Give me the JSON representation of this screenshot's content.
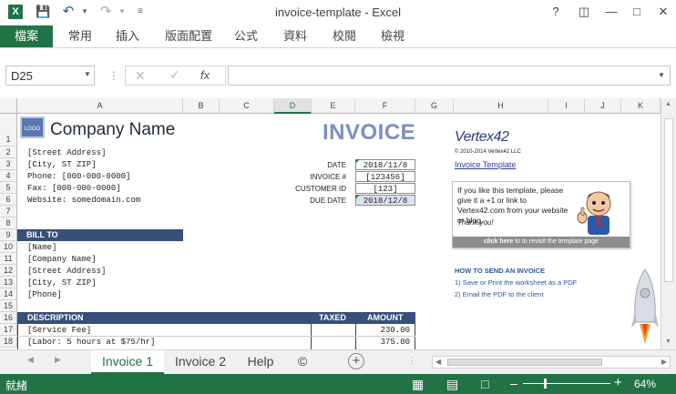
{
  "window": {
    "title": "invoice-template - Excel",
    "app_icon": "X",
    "help": "?"
  },
  "ribbon": {
    "tabs": [
      "檔案",
      "常用",
      "插入",
      "版面配置",
      "公式",
      "資料",
      "校閱",
      "檢視"
    ]
  },
  "formula_bar": {
    "name_box": "D25",
    "fx": "fx",
    "value": ""
  },
  "columns": [
    "A",
    "B",
    "C",
    "D",
    "E",
    "F",
    "G",
    "H",
    "I",
    "J",
    "K"
  ],
  "rows": [
    "1",
    "2",
    "3",
    "4",
    "5",
    "6",
    "7",
    "8",
    "9",
    "10",
    "11",
    "12",
    "13",
    "14",
    "15",
    "16",
    "17",
    "18"
  ],
  "sheet": {
    "logo_text": "LOGO",
    "company_name": "Company Name",
    "invoice_title": "INVOICE",
    "address_lines": [
      "[Street Address]",
      "[City, ST  ZIP]",
      "Phone: [000-000-0000]",
      "Fax: [000-000-0000]",
      "Website: somedomain.com"
    ],
    "meta_labels": [
      "DATE",
      "INVOICE #",
      "CUSTOMER ID",
      "DUE DATE"
    ],
    "meta_values": [
      "2018/11/8",
      "[123456]",
      "[123]",
      "2018/12/8"
    ],
    "bill_to_header": "BILL TO",
    "bill_to_lines": [
      "[Name]",
      "[Company Name]",
      "[Street Address]",
      "[City, ST  ZIP]",
      "[Phone]"
    ],
    "table_headers": {
      "description": "DESCRIPTION",
      "taxed": "TAXED",
      "amount": "AMOUNT"
    },
    "items": [
      {
        "description": "[Service Fee]",
        "amount": "230.00"
      },
      {
        "description": "[Labor: 5 hours at $75/hr]",
        "amount": "375.00"
      }
    ],
    "vertex_brand": "Vertex42",
    "copyright": "© 2010-2014 Vertex42 LLC",
    "template_link": "Invoice Template",
    "promo_text": "If you like this template, please give it a +1 or link to Vertex42.com from your website or blog.",
    "promo_thanks": "Thank you!",
    "promo_footer_bold": "click here",
    "promo_footer": "to to revisit the template page",
    "how_to_header": "HOW TO SEND AN INVOICE",
    "how_to_1": "1) Save or Print the worksheet as a PDF",
    "how_to_2": "2) Email the PDF to the client"
  },
  "sheet_tabs": [
    "Invoice 1",
    "Invoice 2",
    "Help",
    "©"
  ],
  "status": {
    "mode": "就緒",
    "zoom": "64%"
  }
}
